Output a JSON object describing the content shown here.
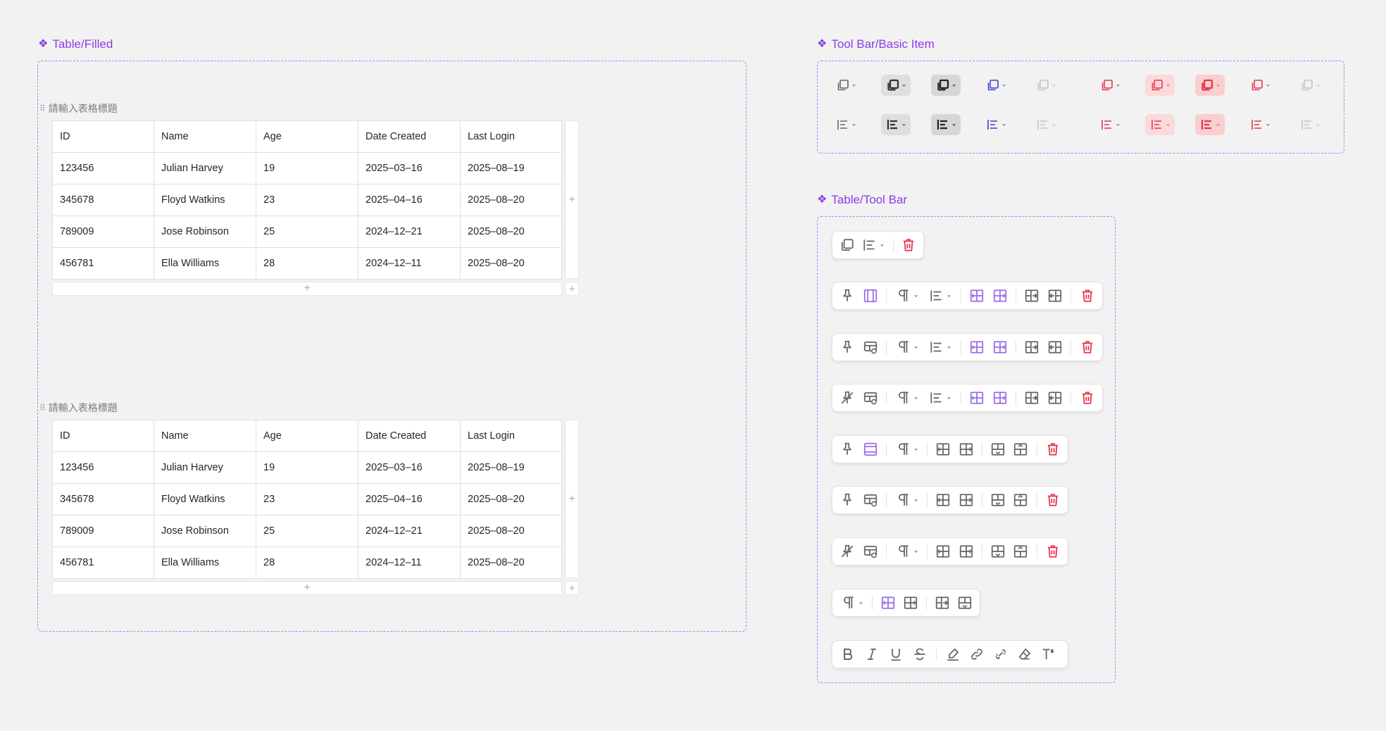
{
  "frames": {
    "table_filled": {
      "title": "Table/Filled",
      "icon": "component-icon"
    },
    "toolbar_basic": {
      "title": "Tool Bar/Basic Item",
      "icon": "component-icon"
    },
    "table_toolbar": {
      "title": "Table/Tool Bar",
      "icon": "component-icon"
    }
  },
  "tables": [
    {
      "caption": "請輸入表格標題",
      "columns": [
        "ID",
        "Name",
        "Age",
        "Date Created",
        "Last Login"
      ],
      "rows": [
        [
          "123456",
          "Julian Harvey",
          "19",
          "2025–03–16",
          "2025–08–19"
        ],
        [
          "345678",
          "Floyd Watkins",
          "23",
          "2025–04–16",
          "2025–08–20"
        ],
        [
          "789009",
          "Jose Robinson",
          "25",
          "2024–12–21",
          "2025–08–20"
        ],
        [
          "456781",
          "Ella Williams",
          "28",
          "2024–12–11",
          "2025–08–20"
        ]
      ]
    },
    {
      "caption": "請輸入表格標題",
      "columns": [
        "ID",
        "Name",
        "Age",
        "Date Created",
        "Last Login"
      ],
      "rows": [
        [
          "123456",
          "Julian Harvey",
          "19",
          "2025–03–16",
          "2025–08–19"
        ],
        [
          "345678",
          "Floyd Watkins",
          "23",
          "2025–04–16",
          "2025–08–20"
        ],
        [
          "789009",
          "Jose Robinson",
          "25",
          "2024–12–21",
          "2025–08–20"
        ],
        [
          "456781",
          "Ella Williams",
          "28",
          "2024–12–11",
          "2025–08–20"
        ]
      ]
    }
  ],
  "add_symbol": "+",
  "colors": {
    "accent": "#8a3ee6",
    "frame_border": "#b27ff0",
    "icon_default": "#666666",
    "icon_dark": "#333333",
    "icon_blue": "#3b3fd6",
    "icon_red": "#e8334a",
    "icon_disabled": "#c4c4c4",
    "tool_purple": "#9a6ee6"
  }
}
